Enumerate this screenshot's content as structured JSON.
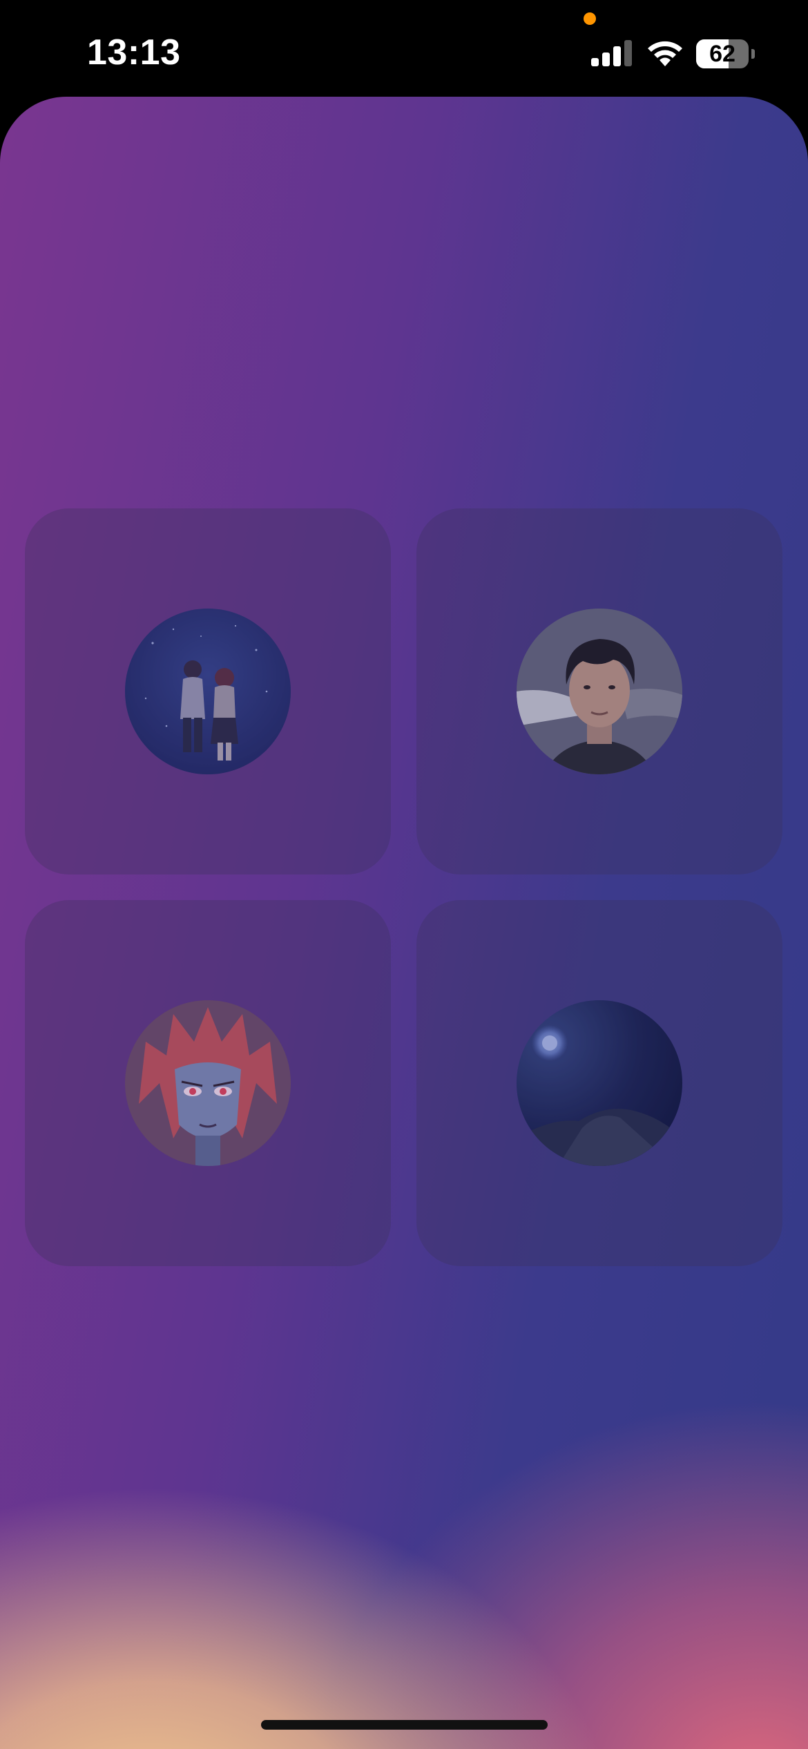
{
  "status_bar": {
    "time": "13:13",
    "battery_percent": "62",
    "battery_level": 0.62,
    "signal_bars_active": 3,
    "signal_bars_total": 4,
    "privacy_indicator_color": "#ff9500"
  },
  "accounts": [
    {
      "id": "account-1",
      "avatar_icon": "anime-couple-starry-sky-avatar"
    },
    {
      "id": "account-2",
      "avatar_icon": "man-portrait-avatar"
    },
    {
      "id": "account-3",
      "avatar_icon": "anime-red-hair-character-avatar"
    },
    {
      "id": "account-4",
      "avatar_icon": "moon-night-landscape-avatar"
    }
  ],
  "colors": {
    "background_top_left": "#7a3690",
    "background_top_right": "#343a88",
    "background_bottom_left": "#f8ce8c",
    "background_bottom_right": "#de687c"
  }
}
